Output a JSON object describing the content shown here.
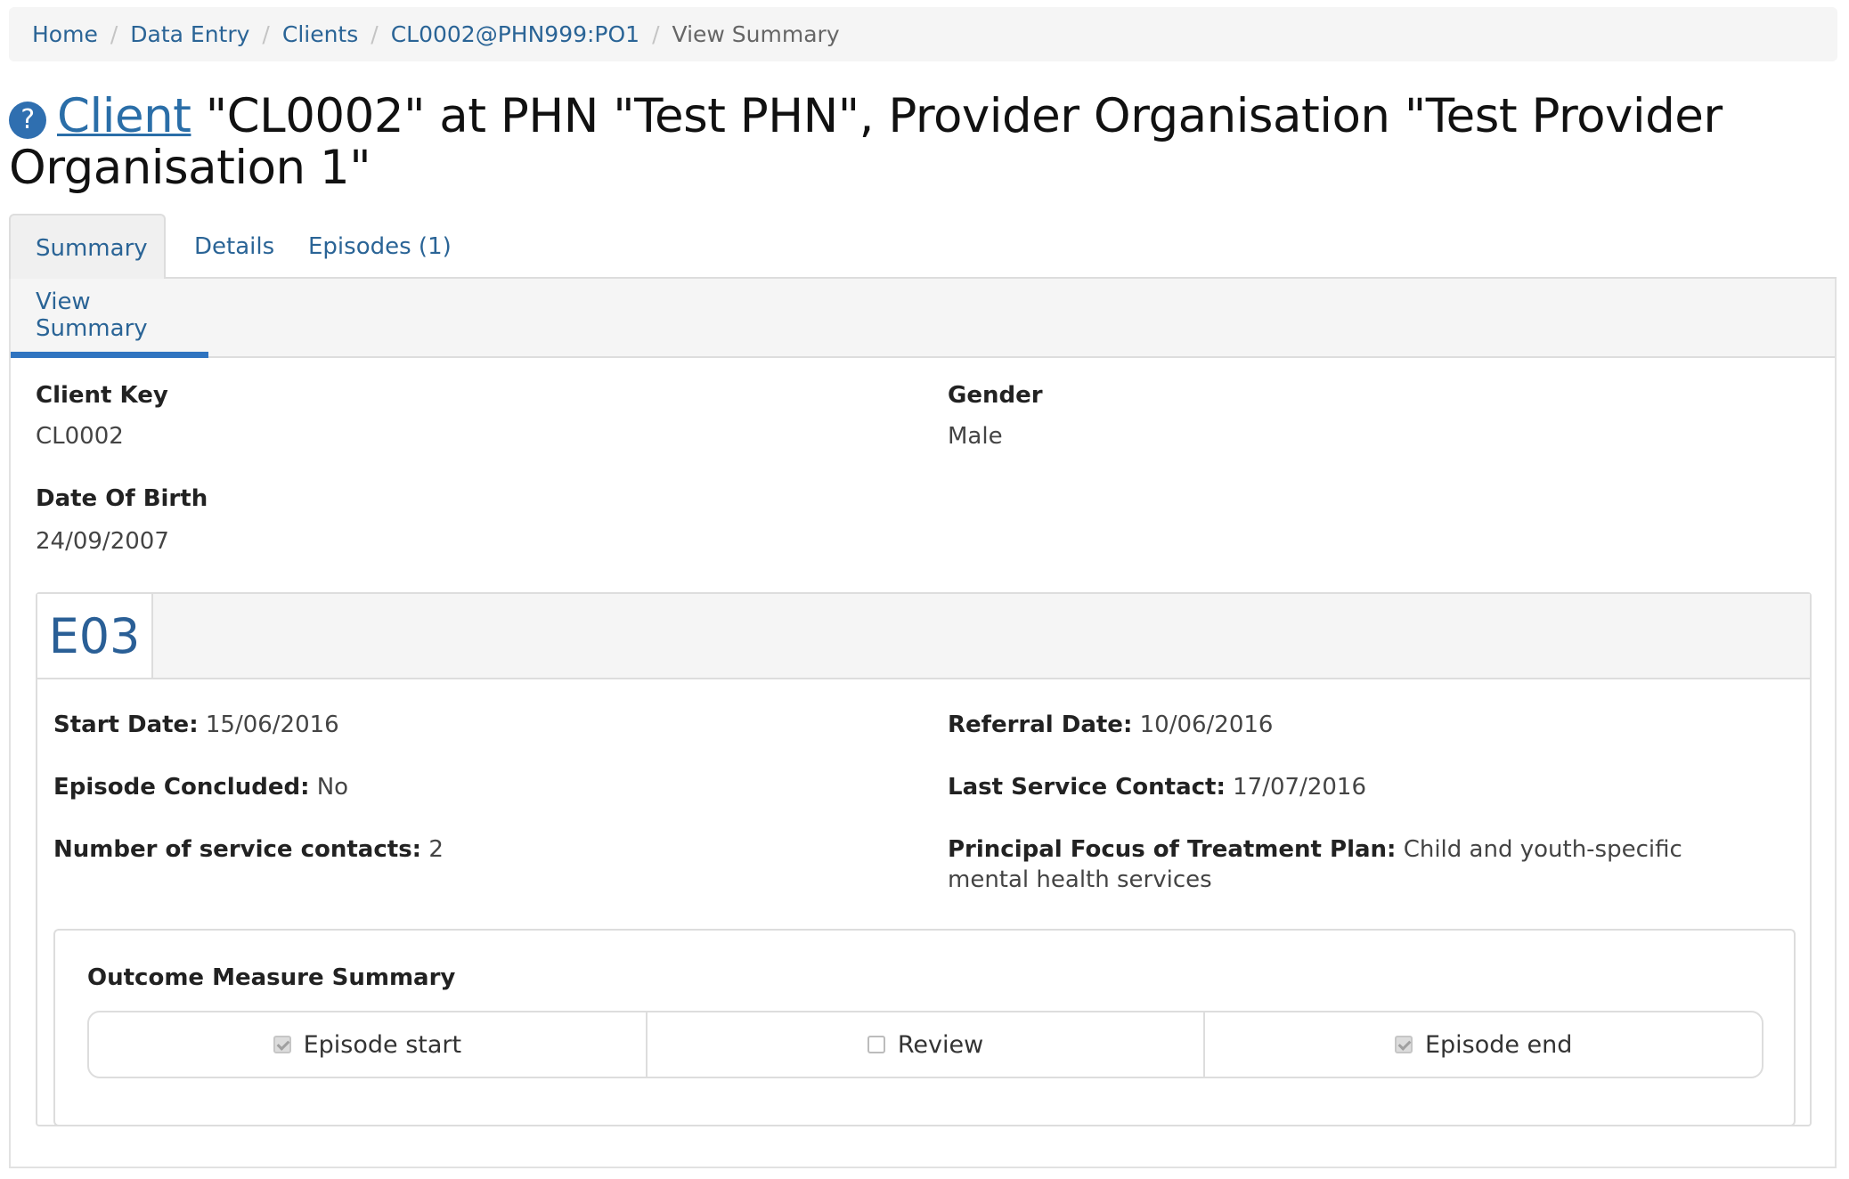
{
  "breadcrumb": {
    "items": [
      "Home",
      "Data Entry",
      "Clients",
      "CL0002@PHN999:PO1"
    ],
    "active": "View Summary",
    "separator": "/"
  },
  "title": {
    "help_icon": "?",
    "link_text": "Client",
    "text": " \"CL0002\" at PHN \"Test PHN\", Provider Organisation \"Test Provider Organisation 1\""
  },
  "tabs": [
    "Summary",
    "Details",
    "Episodes (1)"
  ],
  "subtab": "View Summary",
  "client": {
    "client_key_label": "Client Key",
    "client_key": "CL0002",
    "gender_label": "Gender",
    "gender": "Male",
    "dob_label": "Date Of Birth",
    "dob": "24/09/2007"
  },
  "episode": {
    "id": "E03",
    "start_date_label": "Start Date:",
    "start_date": "15/06/2016",
    "referral_date_label": "Referral Date:",
    "referral_date": "10/06/2016",
    "concluded_label": "Episode Concluded:",
    "concluded": "No",
    "last_contact_label": "Last Service Contact:",
    "last_contact": "17/07/2016",
    "contacts_label": "Number of service contacts:",
    "contacts": "2",
    "focus_label": "Principal Focus of Treatment Plan:",
    "focus": "Child and youth-specific mental health services"
  },
  "outcome": {
    "title": "Outcome Measure Summary",
    "items": [
      {
        "label": "Episode start",
        "checked": true
      },
      {
        "label": "Review",
        "checked": false
      },
      {
        "label": "Episode end",
        "checked": true
      }
    ]
  }
}
